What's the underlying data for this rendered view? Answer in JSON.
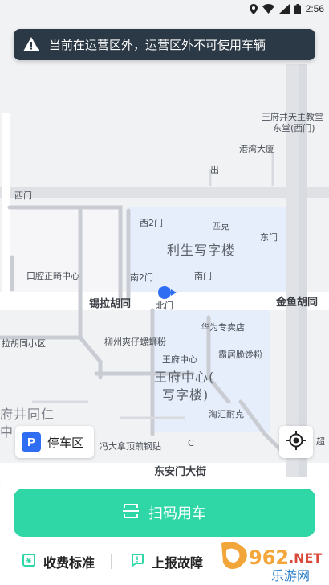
{
  "status_bar": {
    "time": "2:56"
  },
  "notice": {
    "text": "当前在运营区外，运营区外不可使用车辆"
  },
  "map": {
    "labels": {
      "wangfujing_church": "王府井天主教堂",
      "east_church_west_gate": "东堂(西门)",
      "gangwan_building": "港湾大厦",
      "exit": "出",
      "west_gate_left": "西门",
      "west_gate_2": "西2门",
      "pike": "匹克",
      "east_gate": "东门",
      "lisheng_building": "利生写字楼",
      "kouqiang": "口腔正畸中心",
      "south_gate_2": "南2门",
      "south_gate": "南门",
      "xila_hutong": "锡拉胡同",
      "north_gate": "北门",
      "jinyu_hutong": "金鱼胡同",
      "huawei_store": "华为专卖店",
      "xila_community": "拉胡同小区",
      "liuzhou_luosifen": "柳州爽仔螺蛳粉",
      "wangfu_center_west": "王府中心",
      "baju_bun": "霸居脆馋粉",
      "wangfu_center_building": "王府中心(",
      "office_building": "写字楼)",
      "wangfujing_tongren": "府井同仁",
      "zhong": "中",
      "taohuiyaike": "淘汇耐克",
      "fengdana": "冯大拿顶煎钢贴",
      "c_marker": "C",
      "chao": "超",
      "dong_anmen": "东安门大街"
    }
  },
  "parking_chip": {
    "badge": "P",
    "label": "停车区"
  },
  "scan_button": {
    "label": "扫码用车"
  },
  "actions": {
    "fee": "收费标准",
    "report": "上报故障"
  },
  "watermark": {
    "brand": "962",
    "suffix": ".NET",
    "caption": "乐游网"
  },
  "colors": {
    "accent": "#2fd6a6",
    "notice_bg": "#2b3845",
    "parking_blue": "#2f6df2",
    "zone_blue": "#e6eefb"
  }
}
